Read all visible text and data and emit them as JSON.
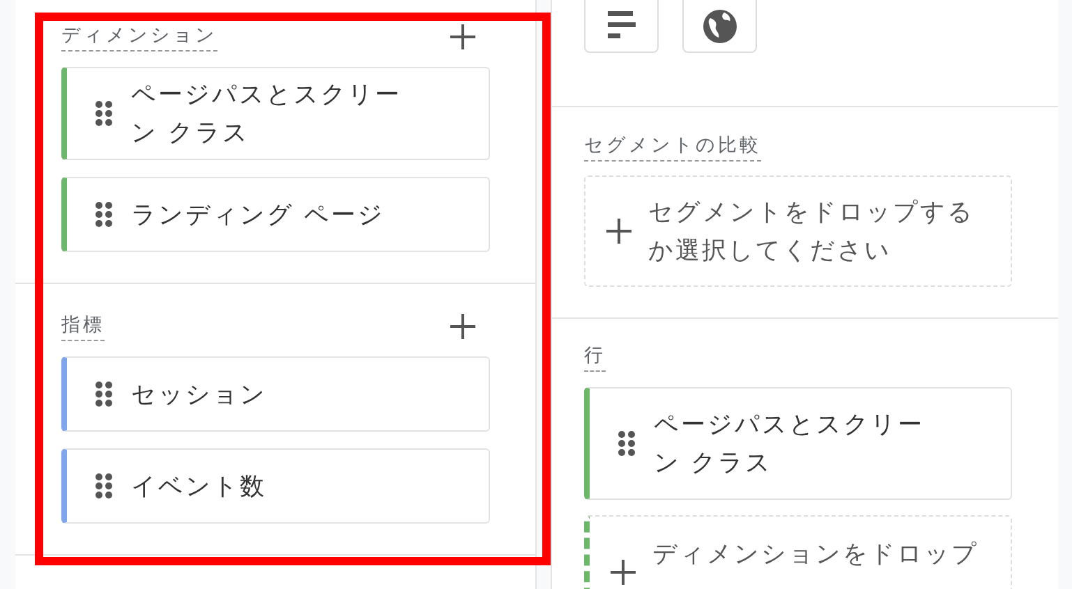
{
  "left_panel": {
    "sections": [
      {
        "title": "ディメンション",
        "chips": [
          {
            "label": "ページパスとスクリーン クラス",
            "color": "#6cb86a"
          },
          {
            "label": "ランディング ページ",
            "color": "#6cb86a"
          }
        ]
      },
      {
        "title": "指標",
        "chips": [
          {
            "label": "セッション",
            "color": "#7ea6ef"
          },
          {
            "label": "イベント数",
            "color": "#7ea6ef"
          }
        ]
      }
    ]
  },
  "right_panel": {
    "segment_comparison": {
      "title": "セグメントの比較",
      "drop_text": "セグメントをドロップするか選択してください"
    },
    "rows": {
      "title": "行",
      "chips": [
        {
          "label": "ページパスとスクリーン クラス",
          "color": "#6cb86a"
        }
      ],
      "drop": {
        "text": "ディメンションをドロップ",
        "color": "#6cb86a"
      }
    }
  }
}
